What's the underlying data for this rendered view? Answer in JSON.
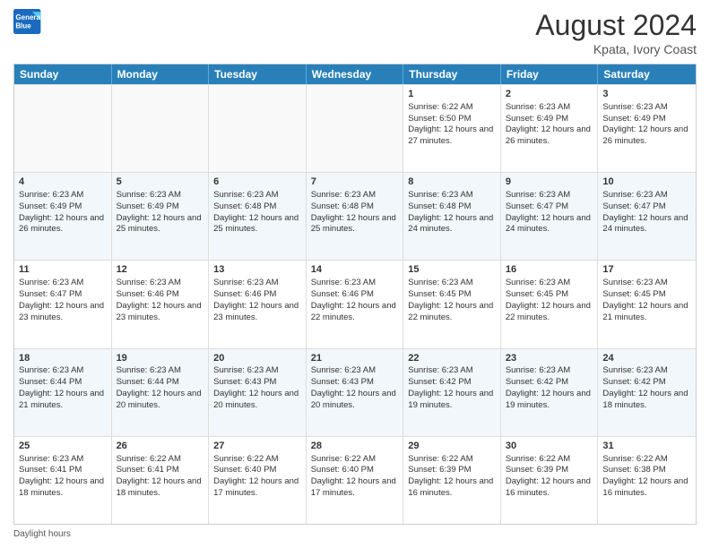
{
  "header": {
    "logo_line1": "General",
    "logo_line2": "Blue",
    "month_year": "August 2024",
    "location": "Kpata, Ivory Coast"
  },
  "days_of_week": [
    "Sunday",
    "Monday",
    "Tuesday",
    "Wednesday",
    "Thursday",
    "Friday",
    "Saturday"
  ],
  "weeks": [
    [
      {
        "day": "",
        "empty": true
      },
      {
        "day": "",
        "empty": true
      },
      {
        "day": "",
        "empty": true
      },
      {
        "day": "",
        "empty": true
      },
      {
        "day": "1",
        "sunrise": "6:22 AM",
        "sunset": "6:50 PM",
        "daylight": "12 hours and 27 minutes."
      },
      {
        "day": "2",
        "sunrise": "6:23 AM",
        "sunset": "6:49 PM",
        "daylight": "12 hours and 26 minutes."
      },
      {
        "day": "3",
        "sunrise": "6:23 AM",
        "sunset": "6:49 PM",
        "daylight": "12 hours and 26 minutes."
      }
    ],
    [
      {
        "day": "4",
        "sunrise": "6:23 AM",
        "sunset": "6:49 PM",
        "daylight": "12 hours and 26 minutes."
      },
      {
        "day": "5",
        "sunrise": "6:23 AM",
        "sunset": "6:49 PM",
        "daylight": "12 hours and 25 minutes."
      },
      {
        "day": "6",
        "sunrise": "6:23 AM",
        "sunset": "6:48 PM",
        "daylight": "12 hours and 25 minutes."
      },
      {
        "day": "7",
        "sunrise": "6:23 AM",
        "sunset": "6:48 PM",
        "daylight": "12 hours and 25 minutes."
      },
      {
        "day": "8",
        "sunrise": "6:23 AM",
        "sunset": "6:48 PM",
        "daylight": "12 hours and 24 minutes."
      },
      {
        "day": "9",
        "sunrise": "6:23 AM",
        "sunset": "6:47 PM",
        "daylight": "12 hours and 24 minutes."
      },
      {
        "day": "10",
        "sunrise": "6:23 AM",
        "sunset": "6:47 PM",
        "daylight": "12 hours and 24 minutes."
      }
    ],
    [
      {
        "day": "11",
        "sunrise": "6:23 AM",
        "sunset": "6:47 PM",
        "daylight": "12 hours and 23 minutes."
      },
      {
        "day": "12",
        "sunrise": "6:23 AM",
        "sunset": "6:46 PM",
        "daylight": "12 hours and 23 minutes."
      },
      {
        "day": "13",
        "sunrise": "6:23 AM",
        "sunset": "6:46 PM",
        "daylight": "12 hours and 23 minutes."
      },
      {
        "day": "14",
        "sunrise": "6:23 AM",
        "sunset": "6:46 PM",
        "daylight": "12 hours and 22 minutes."
      },
      {
        "day": "15",
        "sunrise": "6:23 AM",
        "sunset": "6:45 PM",
        "daylight": "12 hours and 22 minutes."
      },
      {
        "day": "16",
        "sunrise": "6:23 AM",
        "sunset": "6:45 PM",
        "daylight": "12 hours and 22 minutes."
      },
      {
        "day": "17",
        "sunrise": "6:23 AM",
        "sunset": "6:45 PM",
        "daylight": "12 hours and 21 minutes."
      }
    ],
    [
      {
        "day": "18",
        "sunrise": "6:23 AM",
        "sunset": "6:44 PM",
        "daylight": "12 hours and 21 minutes."
      },
      {
        "day": "19",
        "sunrise": "6:23 AM",
        "sunset": "6:44 PM",
        "daylight": "12 hours and 20 minutes."
      },
      {
        "day": "20",
        "sunrise": "6:23 AM",
        "sunset": "6:43 PM",
        "daylight": "12 hours and 20 minutes."
      },
      {
        "day": "21",
        "sunrise": "6:23 AM",
        "sunset": "6:43 PM",
        "daylight": "12 hours and 20 minutes."
      },
      {
        "day": "22",
        "sunrise": "6:23 AM",
        "sunset": "6:42 PM",
        "daylight": "12 hours and 19 minutes."
      },
      {
        "day": "23",
        "sunrise": "6:23 AM",
        "sunset": "6:42 PM",
        "daylight": "12 hours and 19 minutes."
      },
      {
        "day": "24",
        "sunrise": "6:23 AM",
        "sunset": "6:42 PM",
        "daylight": "12 hours and 18 minutes."
      }
    ],
    [
      {
        "day": "25",
        "sunrise": "6:23 AM",
        "sunset": "6:41 PM",
        "daylight": "12 hours and 18 minutes."
      },
      {
        "day": "26",
        "sunrise": "6:22 AM",
        "sunset": "6:41 PM",
        "daylight": "12 hours and 18 minutes."
      },
      {
        "day": "27",
        "sunrise": "6:22 AM",
        "sunset": "6:40 PM",
        "daylight": "12 hours and 17 minutes."
      },
      {
        "day": "28",
        "sunrise": "6:22 AM",
        "sunset": "6:40 PM",
        "daylight": "12 hours and 17 minutes."
      },
      {
        "day": "29",
        "sunrise": "6:22 AM",
        "sunset": "6:39 PM",
        "daylight": "12 hours and 16 minutes."
      },
      {
        "day": "30",
        "sunrise": "6:22 AM",
        "sunset": "6:39 PM",
        "daylight": "12 hours and 16 minutes."
      },
      {
        "day": "31",
        "sunrise": "6:22 AM",
        "sunset": "6:38 PM",
        "daylight": "12 hours and 16 minutes."
      }
    ]
  ],
  "footer": {
    "daylight_label": "Daylight hours"
  }
}
